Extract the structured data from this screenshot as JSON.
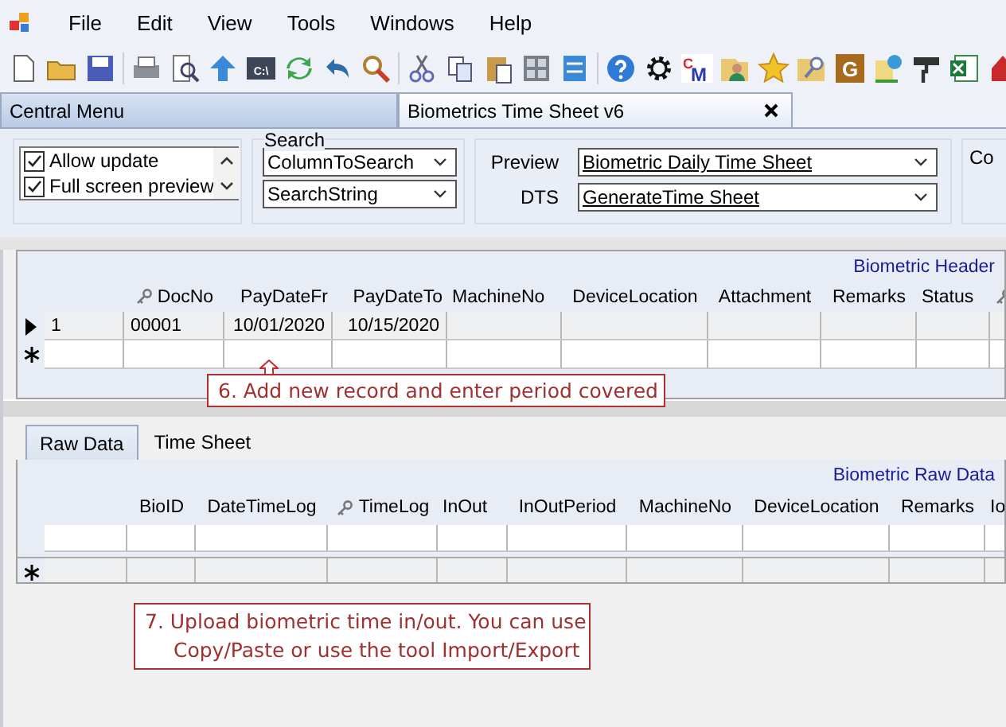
{
  "menu": [
    "File",
    "Edit",
    "View",
    "Tools",
    "Windows",
    "Help"
  ],
  "toolbar_labels": {
    "console": "C:\\",
    "cm_first": "C",
    "cm_second": "M",
    "g": "G"
  },
  "document_tabs": [
    {
      "label": "Central Menu",
      "selected": false
    },
    {
      "label": "Biometrics Time Sheet v6",
      "selected": true
    }
  ],
  "options": [
    {
      "label": "Allow update",
      "checked": true
    },
    {
      "label": "Full screen preview",
      "checked": true
    }
  ],
  "search": {
    "title": "Search",
    "fields": [
      "ColumnToSearch",
      "SearchString"
    ]
  },
  "preview": [
    {
      "label": "Preview",
      "value": "Biometric Daily Time Sheet"
    },
    {
      "label": "DTS",
      "value": "GenerateTime Sheet"
    }
  ],
  "cut_group_label": "Co",
  "header_grid": {
    "title": "Biometric Header",
    "columns": [
      {
        "key": false
      },
      {
        "label": "DocNo",
        "key": true
      },
      {
        "label": "PayDateFr",
        "key": false
      },
      {
        "label": "PayDateTo",
        "key": false
      },
      {
        "label": "MachineNo",
        "key": false
      },
      {
        "label": "DeviceLocation",
        "key": false
      },
      {
        "label": "Attachment",
        "key": false
      },
      {
        "label": "Remarks",
        "key": false
      },
      {
        "label": "Status",
        "key": false
      },
      {
        "key": true
      }
    ],
    "rows": [
      {
        "kind": "current",
        "cells": [
          "1",
          "00001",
          "10/01/2020",
          "10/15/2020"
        ]
      },
      {
        "kind": "new",
        "cells": []
      }
    ]
  },
  "note_6": "6. Add new record and enter period covered",
  "detail_tabs": [
    {
      "label": "Raw Data",
      "selected": true
    },
    {
      "label": "Time Sheet",
      "selected": false
    }
  ],
  "raw_grid": {
    "title": "Biometric Raw Data",
    "columns": [
      {
        "key": false
      },
      {
        "label": "BioID",
        "key": false
      },
      {
        "label": "DateTimeLog",
        "key": false
      },
      {
        "label": "TimeLog",
        "key": true
      },
      {
        "label": "InOut",
        "key": false
      },
      {
        "label": "InOutPeriod",
        "key": false
      },
      {
        "label": "MachineNo",
        "key": false
      },
      {
        "label": "DeviceLocation",
        "key": false
      },
      {
        "label": "Remarks",
        "key": false
      },
      {
        "label": "Io",
        "key": false
      }
    ],
    "rows": [
      {
        "kind": "blank",
        "cells": []
      },
      {
        "kind": "new",
        "cells": []
      }
    ]
  },
  "note_7": [
    "7. Upload biometric time in/out. You can use",
    "Copy/Paste  or use the tool Import/Export"
  ]
}
